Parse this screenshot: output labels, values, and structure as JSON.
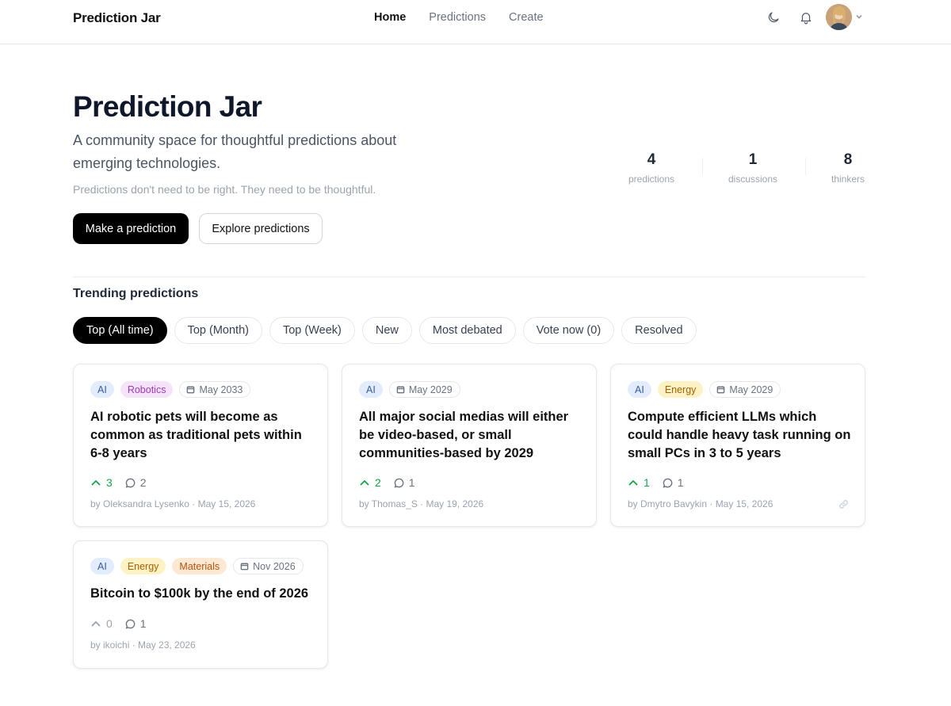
{
  "nav": {
    "brand": "Prediction Jar",
    "links": [
      {
        "label": "Home",
        "active": true
      },
      {
        "label": "Predictions",
        "active": false
      },
      {
        "label": "Create",
        "active": false
      }
    ],
    "icons": [
      "moon-icon",
      "bell-icon",
      "avatar",
      "chevron-down-icon"
    ]
  },
  "hero": {
    "title": "Prediction Jar",
    "subtitle": "A community space for thoughtful predictions about emerging technologies.",
    "note": "Predictions don't need to be right. They need to be thoughtful.",
    "primary_button": "Make a prediction",
    "secondary_button": "Explore predictions"
  },
  "stats": [
    {
      "value": "4",
      "label": "predictions"
    },
    {
      "value": "1",
      "label": "discussions"
    },
    {
      "value": "8",
      "label": "thinkers"
    }
  ],
  "trending": {
    "title": "Trending predictions",
    "filters": [
      {
        "label": "Top (All time)",
        "active": true
      },
      {
        "label": "Top (Month)",
        "active": false
      },
      {
        "label": "Top (Week)",
        "active": false
      },
      {
        "label": "New",
        "active": false
      },
      {
        "label": "Most debated",
        "active": false
      },
      {
        "label": "Vote now (0)",
        "active": false
      },
      {
        "label": "Resolved",
        "active": false
      }
    ]
  },
  "cards": [
    {
      "tags": [
        "AI",
        "Robotics"
      ],
      "date": "May 2033",
      "title": "AI robotic pets will become as common as traditional pets within 6-8 years",
      "votes": "3",
      "comments": "2",
      "byline": "by Oleksandra Lysenko · May 15, 2026"
    },
    {
      "tags": [
        "AI"
      ],
      "date": "May 2029",
      "title": "All major social medias will either be video-based, or small communities-based by 2029",
      "votes": "2",
      "comments": "1",
      "byline": "by Thomas_S · May 19, 2026"
    },
    {
      "tags": [
        "AI",
        "Energy"
      ],
      "date": "May 2029",
      "title": "Compute efficient LLMs which could handle heavy task running on small PCs in 3 to 5 years",
      "votes": "1",
      "comments": "1",
      "byline": "by Dmytro Bavykin · May 15, 2026"
    },
    {
      "tags": [
        "AI",
        "Energy",
        "Materials"
      ],
      "date": "Nov 2026",
      "title": "Bitcoin to $100k by the end of 2026",
      "votes": "0",
      "comments": "1",
      "byline": "by ikoichi · May 23, 2026"
    }
  ],
  "colors": {
    "accent": "#000000",
    "upvote": "#16a34a",
    "tag_ai_bg": "#e3ecfd",
    "tag_robotics_bg": "#f5e3fa",
    "tag_energy_bg": "#fdf2c4",
    "tag_materials_bg": "#fde8d4"
  }
}
